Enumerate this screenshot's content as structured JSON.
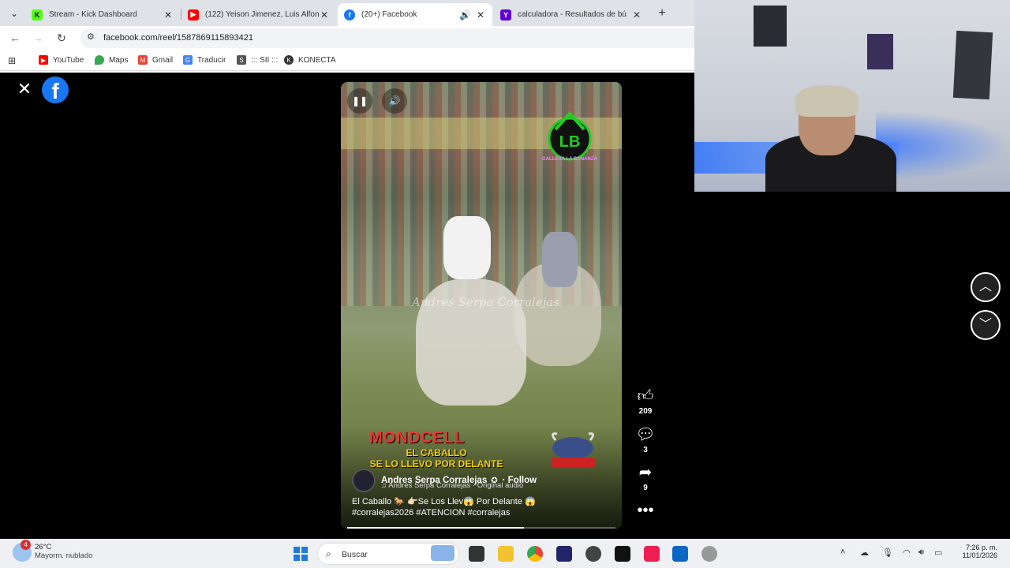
{
  "browser": {
    "tabs": [
      {
        "title": "Stream - Kick Dashboard",
        "favicon": "kick-icon",
        "active": false
      },
      {
        "title": "(122) Yeison Jimenez, Luis Alfon",
        "favicon": "youtube-icon",
        "active": false
      },
      {
        "title": "(20+) Facebook",
        "favicon": "facebook-icon",
        "active": true
      },
      {
        "title": "calculadora - Resultados de bú",
        "favicon": "yahoo-icon",
        "active": false
      }
    ],
    "new_tab_label": "+",
    "url": "facebook.com/reel/1587869115893421",
    "bookmarks": [
      {
        "label": "YouTube",
        "icon": "youtube-icon"
      },
      {
        "label": "Maps",
        "icon": "maps-icon"
      },
      {
        "label": "Gmail",
        "icon": "gmail-icon"
      },
      {
        "label": "Traducir",
        "icon": "translate-icon"
      },
      {
        "label": "::: SII :::",
        "icon": "sii-icon"
      },
      {
        "label": "KONECTA",
        "icon": "konecta-icon"
      }
    ]
  },
  "reel": {
    "watermark": "Andres Serpa Corralejas",
    "brand_logo_text": "GALLERA LA BONANZA",
    "promo_brand": "MONDCELL",
    "promo_line1": "EL CABALLO",
    "promo_line2": "SE LO LLEVO POR DELANTE",
    "author": "Andres Serpa Corralejas",
    "follow_label": "· Follow",
    "audio": "Andres Serpa Corralejas · Original audio",
    "caption_line1": "El Caballo 🐎 👉🏻Se Los Llev😱 Por Delante 😱",
    "caption_line2": "#corralejas2026  #ATENCION  #corralejas",
    "progress": 0.66,
    "likes": "209",
    "comments": "3",
    "shares": "9"
  },
  "taskbar": {
    "weather_badge": "4",
    "temperature": "26°C",
    "condition": "Mayorm. nublado",
    "search_placeholder": "Buscar",
    "time": "7:26 p. m.",
    "date": "11/01/2026"
  },
  "colors": {
    "facebook_blue": "#1877f2",
    "windows_blue": "#1e7be0"
  }
}
